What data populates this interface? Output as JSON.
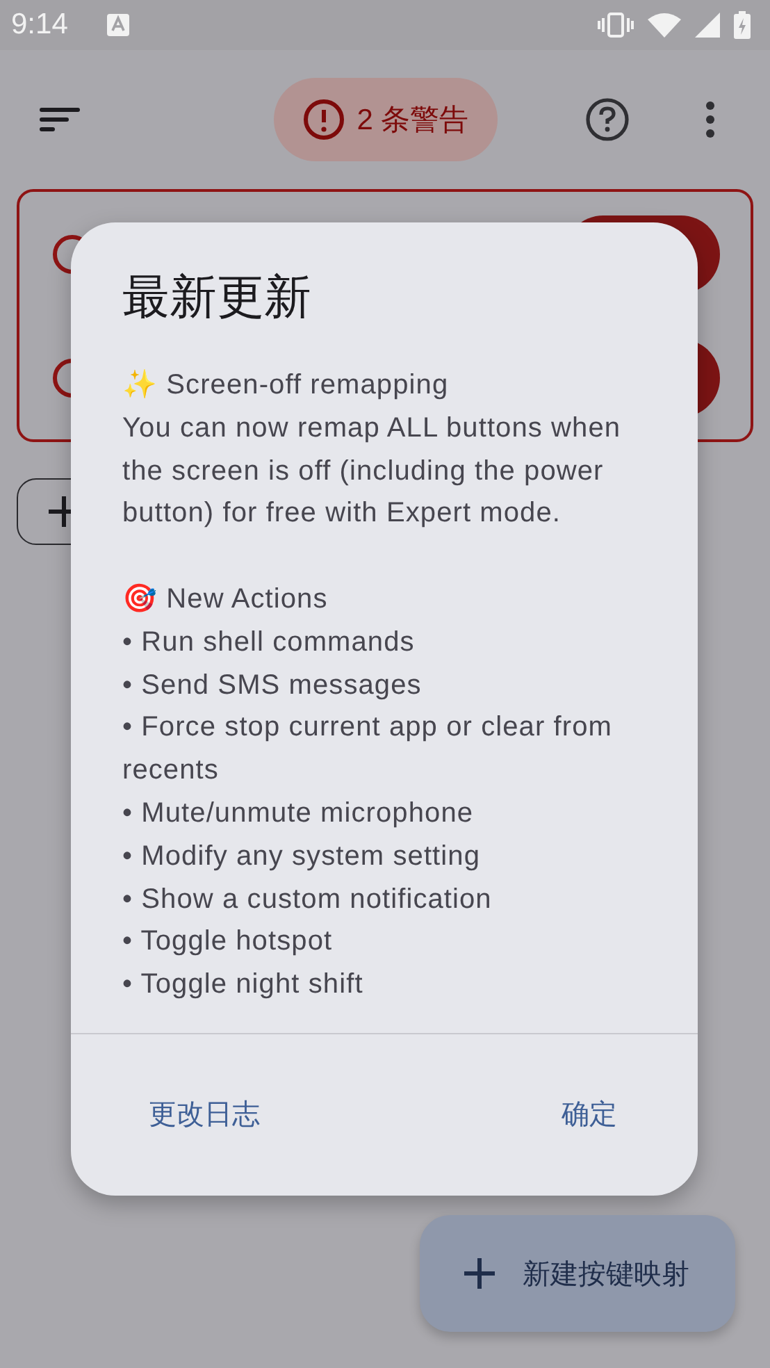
{
  "status_bar": {
    "time": "9:14"
  },
  "app_bar": {
    "warning_chip": "2 条警告"
  },
  "dialog": {
    "title": "最新更新",
    "sections": [
      {
        "heading": "✨ Screen-off remapping",
        "lines": [
          "You can now remap ALL buttons when the screen is off (including the power button) for free with Expert mode."
        ]
      },
      {
        "heading": "🎯 New Actions",
        "lines": [
          "• Run shell commands",
          "• Send SMS messages",
          "• Force stop current app or clear from recents",
          "• Mute/unmute microphone",
          "• Modify any system setting",
          "• Show a custom notification",
          "• Toggle hotspot",
          "• Toggle night shift"
        ]
      }
    ],
    "buttons": [
      "更改日志",
      "确定"
    ]
  },
  "fab": {
    "label": "新建按键映射"
  }
}
